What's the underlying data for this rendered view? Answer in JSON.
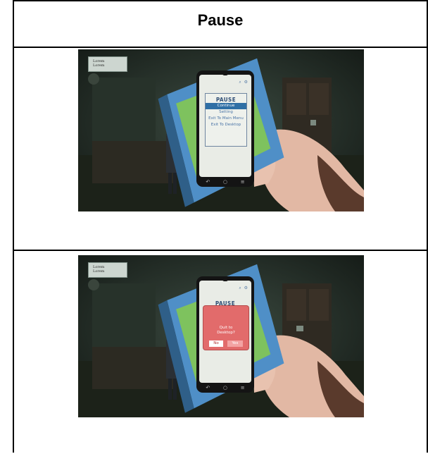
{
  "header": {
    "title": "Pause"
  },
  "hud": {
    "line1": "Lorem",
    "line2": "Lorem"
  },
  "pause_menu": {
    "title": "PAUSE",
    "items": [
      "Continue",
      "Setting",
      "Exit To Main Menu",
      "Exit To Desktop"
    ],
    "selected": "Continue"
  },
  "quit_dialog": {
    "title": "PAUSE",
    "message_line1": "Quit to",
    "message_line2": "Desktop?",
    "no_label": "No",
    "yes_label": "Yes"
  },
  "phone_icons": {
    "top": "⌕ ⚙",
    "nav": [
      "↶",
      "○",
      "≡"
    ]
  },
  "colors": {
    "scene_bg": "#1f2a22",
    "accent": "#2f6fa5",
    "dialog": "#e26b6b"
  }
}
